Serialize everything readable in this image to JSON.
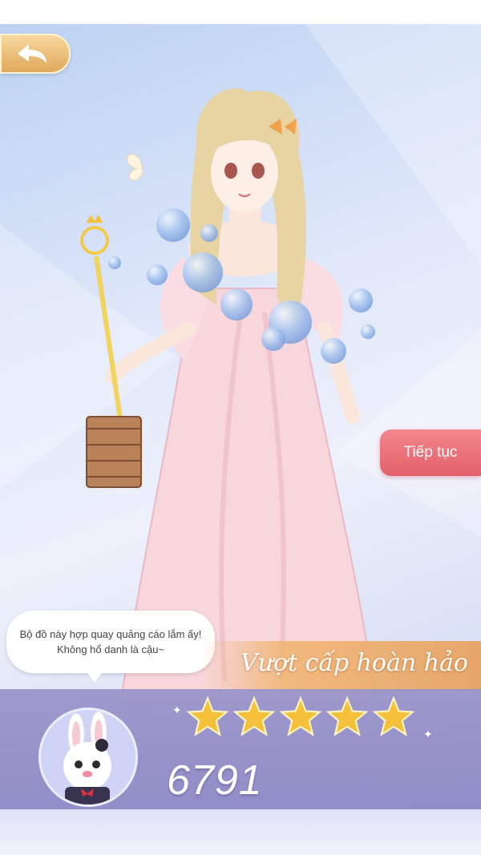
{
  "nav": {
    "back_label": "back"
  },
  "scene": {
    "character": "anime girl in pink gown with magic wand and handbag"
  },
  "continue_button": {
    "label": "Tiếp tục"
  },
  "dialog": {
    "text": "Bộ đồ này hợp quay quảng cáo lắm ấy! Không hổ danh là cậu~"
  },
  "result": {
    "rank_label": "Vượt cấp hoàn hảo",
    "stars": 5,
    "score": "6791"
  },
  "colors": {
    "gold": "#f5c13a",
    "continue": "#e66b73",
    "panel": "#9691c8",
    "banner": "#e8a05a"
  },
  "icons": {
    "back": "back-arrow-icon",
    "star": "star-icon",
    "mascot": "rabbit-mascot"
  }
}
